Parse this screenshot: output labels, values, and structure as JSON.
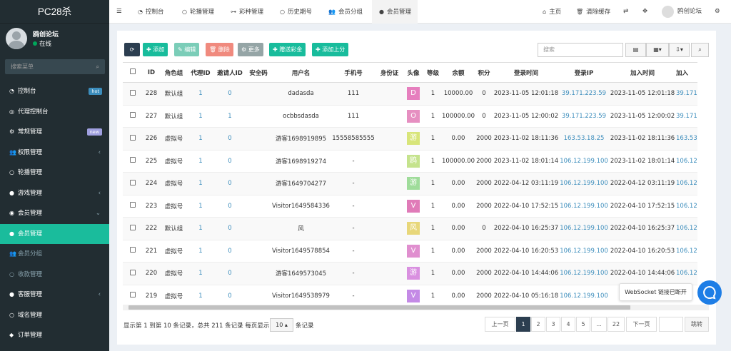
{
  "app": {
    "title": "PC28杀"
  },
  "user": {
    "name": "鸥创论坛",
    "status": "在线"
  },
  "sidebar": {
    "search_placeholder": "搜索菜单",
    "items": [
      {
        "label": "控制台",
        "icon": "dashboard-icon",
        "badge": "hot",
        "badge_color": "#3c8dbc"
      },
      {
        "label": "代理控制台",
        "icon": "globe-icon"
      },
      {
        "label": "常规管理",
        "icon": "cogs-icon",
        "badge": "new",
        "badge_color": "#a0a0e0"
      },
      {
        "label": "权限管理",
        "icon": "group-icon",
        "arrow": "‹"
      },
      {
        "label": "轮播管理",
        "icon": "circle-icon"
      },
      {
        "label": "游戏管理",
        "icon": "bomb-icon",
        "arrow": "‹"
      },
      {
        "label": "会员管理",
        "icon": "user-circle-icon",
        "arrow": "⌄"
      },
      {
        "label": "会员管理",
        "icon": "user-icon"
      },
      {
        "label": "会员分组",
        "icon": "users-icon"
      },
      {
        "label": "收款管理",
        "icon": "circle-icon"
      },
      {
        "label": "客服管理",
        "icon": "comment-icon",
        "arrow": "‹"
      },
      {
        "label": "域名管理",
        "icon": "circle-icon"
      },
      {
        "label": "订单管理",
        "icon": "cube-icon"
      }
    ]
  },
  "topbar": {
    "menu_icon": "☰",
    "tabs": [
      "控制台",
      "轮播管理",
      "彩种管理",
      "历史期号",
      "会员分组",
      "会员管理"
    ],
    "right": [
      "主页",
      "清除缓存",
      "鸥创论坛"
    ]
  },
  "toolbar": {
    "refresh": "⟳",
    "add": "添加",
    "edit": "编辑",
    "delete": "删除",
    "more": "更多",
    "gift": "赠送彩金",
    "topup": "添加上分",
    "search_placeholder": "搜索"
  },
  "table": {
    "columns": [
      "ID",
      "角色组",
      "代理ID",
      "邀请人ID",
      "安全码",
      "用户名",
      "手机号",
      "身份证",
      "头像",
      "等级",
      "余额",
      "积分",
      "登录时间",
      "登录IP",
      "加入时间",
      "加入"
    ],
    "rows": [
      {
        "id": "228",
        "group": "默认组",
        "agent": "1",
        "inviter": "0",
        "code": "",
        "username": "dadasda",
        "phone": "111",
        "idcard": "",
        "avatar": "D",
        "avatar_color": "#e67fbe",
        "level": "1",
        "balance": "10000.00",
        "points": "0",
        "login_time": "2023-11-05 12:01:18",
        "login_ip": "39.171.223.59",
        "join_time": "2023-11-05 12:01:18",
        "join_ip": "39.171"
      },
      {
        "id": "227",
        "group": "默认组",
        "agent": "1",
        "inviter": "1",
        "code": "",
        "username": "ocbbsdasda",
        "phone": "111",
        "idcard": "",
        "avatar": "O",
        "avatar_color": "#e68fc1",
        "level": "1",
        "balance": "100000.00",
        "points": "0",
        "login_time": "2023-11-05 12:00:02",
        "login_ip": "39.171.223.59",
        "join_time": "2023-11-05 12:00:02",
        "join_ip": "39.171"
      },
      {
        "id": "226",
        "group": "虚拟号",
        "agent": "1",
        "inviter": "0",
        "code": "",
        "username": "游客1698919895",
        "phone": "15558585555",
        "idcard": "",
        "avatar": "游",
        "avatar_color": "#d8e57a",
        "level": "1",
        "balance": "0.00",
        "points": "2000",
        "login_time": "2023-11-02 18:11:36",
        "login_ip": "163.53.18.25",
        "join_time": "2023-11-02 18:11:36",
        "join_ip": "163.53"
      },
      {
        "id": "225",
        "group": "虚拟号",
        "agent": "1",
        "inviter": "0",
        "code": "",
        "username": "游客1698919274",
        "phone": "-",
        "idcard": "",
        "avatar": "鸥",
        "avatar_color": "#c5e38d",
        "level": "1",
        "balance": "100000.00",
        "points": "2000",
        "login_time": "2023-11-02 18:01:14",
        "login_ip": "106.12.199.100",
        "join_time": "2023-11-02 18:01:14",
        "join_ip": "106.12"
      },
      {
        "id": "224",
        "group": "虚拟号",
        "agent": "1",
        "inviter": "0",
        "code": "",
        "username": "游客1649704277",
        "phone": "-",
        "idcard": "",
        "avatar": "游",
        "avatar_color": "#9fdc9a",
        "level": "1",
        "balance": "0.00",
        "points": "2000",
        "login_time": "2022-04-12 03:11:19",
        "login_ip": "106.12.199.100",
        "join_time": "2022-04-12 03:11:19",
        "join_ip": "106.12"
      },
      {
        "id": "223",
        "group": "虚拟号",
        "agent": "1",
        "inviter": "0",
        "code": "",
        "username": "Visitor1649584336",
        "phone": "-",
        "idcard": "",
        "avatar": "V",
        "avatar_color": "#e07bb8",
        "level": "1",
        "balance": "0.00",
        "points": "2000",
        "login_time": "2022-04-10 17:52:15",
        "login_ip": "106.12.199.100",
        "join_time": "2022-04-10 17:52:15",
        "join_ip": "106.12"
      },
      {
        "id": "222",
        "group": "默认组",
        "agent": "1",
        "inviter": "0",
        "code": "",
        "username": "风",
        "phone": "-",
        "idcard": "",
        "avatar": "风",
        "avatar_color": "#e8d77a",
        "level": "1",
        "balance": "0.00",
        "points": "0",
        "login_time": "2022-04-10 16:25:37",
        "login_ip": "106.12.199.100",
        "join_time": "2022-04-10 16:25:37",
        "join_ip": "106.12"
      },
      {
        "id": "221",
        "group": "虚拟号",
        "agent": "1",
        "inviter": "0",
        "code": "",
        "username": "Visitor1649578854",
        "phone": "-",
        "idcard": "",
        "avatar": "V",
        "avatar_color": "#e08fcf",
        "level": "1",
        "balance": "0.00",
        "points": "2000",
        "login_time": "2022-04-10 16:20:53",
        "login_ip": "106.12.199.100",
        "join_time": "2022-04-10 16:20:53",
        "join_ip": "106.12"
      },
      {
        "id": "220",
        "group": "虚拟号",
        "agent": "1",
        "inviter": "0",
        "code": "",
        "username": "游客1649573045",
        "phone": "-",
        "idcard": "",
        "avatar": "游",
        "avatar_color": "#d990e0",
        "level": "1",
        "balance": "0.00",
        "points": "2000",
        "login_time": "2022-04-10 14:44:06",
        "login_ip": "106.12.199.100",
        "join_time": "2022-04-10 14:44:06",
        "join_ip": "106.12"
      },
      {
        "id": "219",
        "group": "虚拟号",
        "agent": "1",
        "inviter": "0",
        "code": "",
        "username": "Visitor1649538979",
        "phone": "-",
        "idcard": "",
        "avatar": "V",
        "avatar_color": "#c48ae6",
        "level": "1",
        "balance": "0.00",
        "points": "2000",
        "login_time": "2022-04-10 05:16:18",
        "login_ip": "106.12.199.100",
        "join_time": "",
        "join_ip": ""
      }
    ]
  },
  "footer": {
    "summary": "显示第 1 到第 10 条记录，总共 211 条记录 每页显示",
    "page_size": "10",
    "suffix": "条记录",
    "pages": [
      "上一页",
      "1",
      "2",
      "3",
      "4",
      "5",
      "...",
      "22",
      "下一页"
    ],
    "current_page": "1",
    "jump": "跳转"
  },
  "websocket_tip": "WebSocket 链接已断开"
}
